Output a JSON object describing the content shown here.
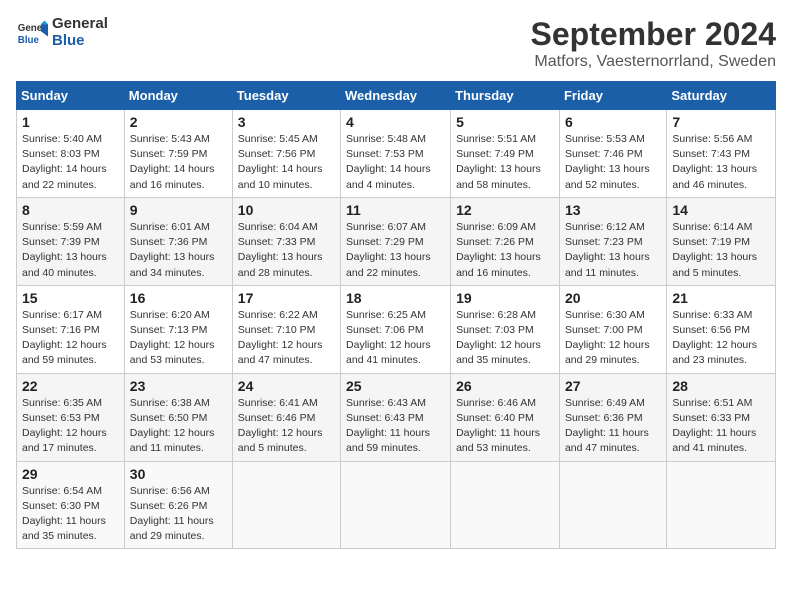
{
  "header": {
    "logo_line1": "General",
    "logo_line2": "Blue",
    "title": "September 2024",
    "subtitle": "Matfors, Vaesternorrland, Sweden"
  },
  "columns": [
    "Sunday",
    "Monday",
    "Tuesday",
    "Wednesday",
    "Thursday",
    "Friday",
    "Saturday"
  ],
  "weeks": [
    [
      {
        "day": "1",
        "info": "Sunrise: 5:40 AM\nSunset: 8:03 PM\nDaylight: 14 hours\nand 22 minutes."
      },
      {
        "day": "2",
        "info": "Sunrise: 5:43 AM\nSunset: 7:59 PM\nDaylight: 14 hours\nand 16 minutes."
      },
      {
        "day": "3",
        "info": "Sunrise: 5:45 AM\nSunset: 7:56 PM\nDaylight: 14 hours\nand 10 minutes."
      },
      {
        "day": "4",
        "info": "Sunrise: 5:48 AM\nSunset: 7:53 PM\nDaylight: 14 hours\nand 4 minutes."
      },
      {
        "day": "5",
        "info": "Sunrise: 5:51 AM\nSunset: 7:49 PM\nDaylight: 13 hours\nand 58 minutes."
      },
      {
        "day": "6",
        "info": "Sunrise: 5:53 AM\nSunset: 7:46 PM\nDaylight: 13 hours\nand 52 minutes."
      },
      {
        "day": "7",
        "info": "Sunrise: 5:56 AM\nSunset: 7:43 PM\nDaylight: 13 hours\nand 46 minutes."
      }
    ],
    [
      {
        "day": "8",
        "info": "Sunrise: 5:59 AM\nSunset: 7:39 PM\nDaylight: 13 hours\nand 40 minutes."
      },
      {
        "day": "9",
        "info": "Sunrise: 6:01 AM\nSunset: 7:36 PM\nDaylight: 13 hours\nand 34 minutes."
      },
      {
        "day": "10",
        "info": "Sunrise: 6:04 AM\nSunset: 7:33 PM\nDaylight: 13 hours\nand 28 minutes."
      },
      {
        "day": "11",
        "info": "Sunrise: 6:07 AM\nSunset: 7:29 PM\nDaylight: 13 hours\nand 22 minutes."
      },
      {
        "day": "12",
        "info": "Sunrise: 6:09 AM\nSunset: 7:26 PM\nDaylight: 13 hours\nand 16 minutes."
      },
      {
        "day": "13",
        "info": "Sunrise: 6:12 AM\nSunset: 7:23 PM\nDaylight: 13 hours\nand 11 minutes."
      },
      {
        "day": "14",
        "info": "Sunrise: 6:14 AM\nSunset: 7:19 PM\nDaylight: 13 hours\nand 5 minutes."
      }
    ],
    [
      {
        "day": "15",
        "info": "Sunrise: 6:17 AM\nSunset: 7:16 PM\nDaylight: 12 hours\nand 59 minutes."
      },
      {
        "day": "16",
        "info": "Sunrise: 6:20 AM\nSunset: 7:13 PM\nDaylight: 12 hours\nand 53 minutes."
      },
      {
        "day": "17",
        "info": "Sunrise: 6:22 AM\nSunset: 7:10 PM\nDaylight: 12 hours\nand 47 minutes."
      },
      {
        "day": "18",
        "info": "Sunrise: 6:25 AM\nSunset: 7:06 PM\nDaylight: 12 hours\nand 41 minutes."
      },
      {
        "day": "19",
        "info": "Sunrise: 6:28 AM\nSunset: 7:03 PM\nDaylight: 12 hours\nand 35 minutes."
      },
      {
        "day": "20",
        "info": "Sunrise: 6:30 AM\nSunset: 7:00 PM\nDaylight: 12 hours\nand 29 minutes."
      },
      {
        "day": "21",
        "info": "Sunrise: 6:33 AM\nSunset: 6:56 PM\nDaylight: 12 hours\nand 23 minutes."
      }
    ],
    [
      {
        "day": "22",
        "info": "Sunrise: 6:35 AM\nSunset: 6:53 PM\nDaylight: 12 hours\nand 17 minutes."
      },
      {
        "day": "23",
        "info": "Sunrise: 6:38 AM\nSunset: 6:50 PM\nDaylight: 12 hours\nand 11 minutes."
      },
      {
        "day": "24",
        "info": "Sunrise: 6:41 AM\nSunset: 6:46 PM\nDaylight: 12 hours\nand 5 minutes."
      },
      {
        "day": "25",
        "info": "Sunrise: 6:43 AM\nSunset: 6:43 PM\nDaylight: 11 hours\nand 59 minutes."
      },
      {
        "day": "26",
        "info": "Sunrise: 6:46 AM\nSunset: 6:40 PM\nDaylight: 11 hours\nand 53 minutes."
      },
      {
        "day": "27",
        "info": "Sunrise: 6:49 AM\nSunset: 6:36 PM\nDaylight: 11 hours\nand 47 minutes."
      },
      {
        "day": "28",
        "info": "Sunrise: 6:51 AM\nSunset: 6:33 PM\nDaylight: 11 hours\nand 41 minutes."
      }
    ],
    [
      {
        "day": "29",
        "info": "Sunrise: 6:54 AM\nSunset: 6:30 PM\nDaylight: 11 hours\nand 35 minutes."
      },
      {
        "day": "30",
        "info": "Sunrise: 6:56 AM\nSunset: 6:26 PM\nDaylight: 11 hours\nand 29 minutes."
      },
      {
        "day": "",
        "info": ""
      },
      {
        "day": "",
        "info": ""
      },
      {
        "day": "",
        "info": ""
      },
      {
        "day": "",
        "info": ""
      },
      {
        "day": "",
        "info": ""
      }
    ]
  ]
}
